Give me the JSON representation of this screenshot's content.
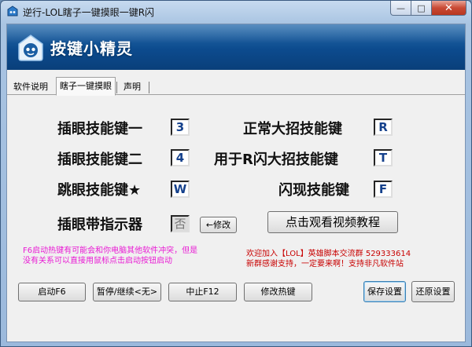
{
  "window": {
    "title": "逆行-LOL瞎子一键摸眼一键R闪",
    "buttons": {
      "minimize": "—",
      "maximize": "□",
      "close": "✕"
    }
  },
  "banner": {
    "logo_text": "按键小精灵"
  },
  "tabs": [
    {
      "label": "软件说明",
      "active": false
    },
    {
      "label": "瞎子一键摸眼",
      "active": true
    },
    {
      "label": "声明",
      "active": false
    }
  ],
  "settings": {
    "ward_key1": {
      "label": "插眼技能键一",
      "value": "3"
    },
    "ward_key2": {
      "label": "插眼技能键二",
      "value": "4"
    },
    "jump_key": {
      "label": "跳眼技能键★",
      "value": "W"
    },
    "ward_indicator": {
      "label": "插眼带指示器",
      "value": "否",
      "modify_label": "←修改"
    },
    "ult_key": {
      "label": "正常大招技能键",
      "value": "R"
    },
    "rflash_key": {
      "label": "用于R闪大招技能键",
      "value": "T"
    },
    "flash_key": {
      "label": "闪现技能键",
      "value": "F"
    },
    "video_button": "点击观看视频教程"
  },
  "notes": {
    "hotkey_warning": [
      "F6启动热键有可能会和你电脑其他软件冲突，但是",
      "没有关系可以直接用鼠标点击启动按钮启动"
    ],
    "community": [
      "欢迎加入【LOL】英雄脚本交流群 529333614",
      "新群感谢支持，一定要来啊！支持非凡软件站"
    ]
  },
  "buttons": {
    "start": "启动F6",
    "pause": "暂停/继续<无>",
    "stop": "中止F12",
    "hotkey": "修改热键",
    "save": "保存设置",
    "restore": "还原设置"
  },
  "colors": {
    "banner": "#0c4b8e",
    "key_text": "#15418c",
    "note_pink": "#e91bd4",
    "note_red": "#c80000"
  }
}
